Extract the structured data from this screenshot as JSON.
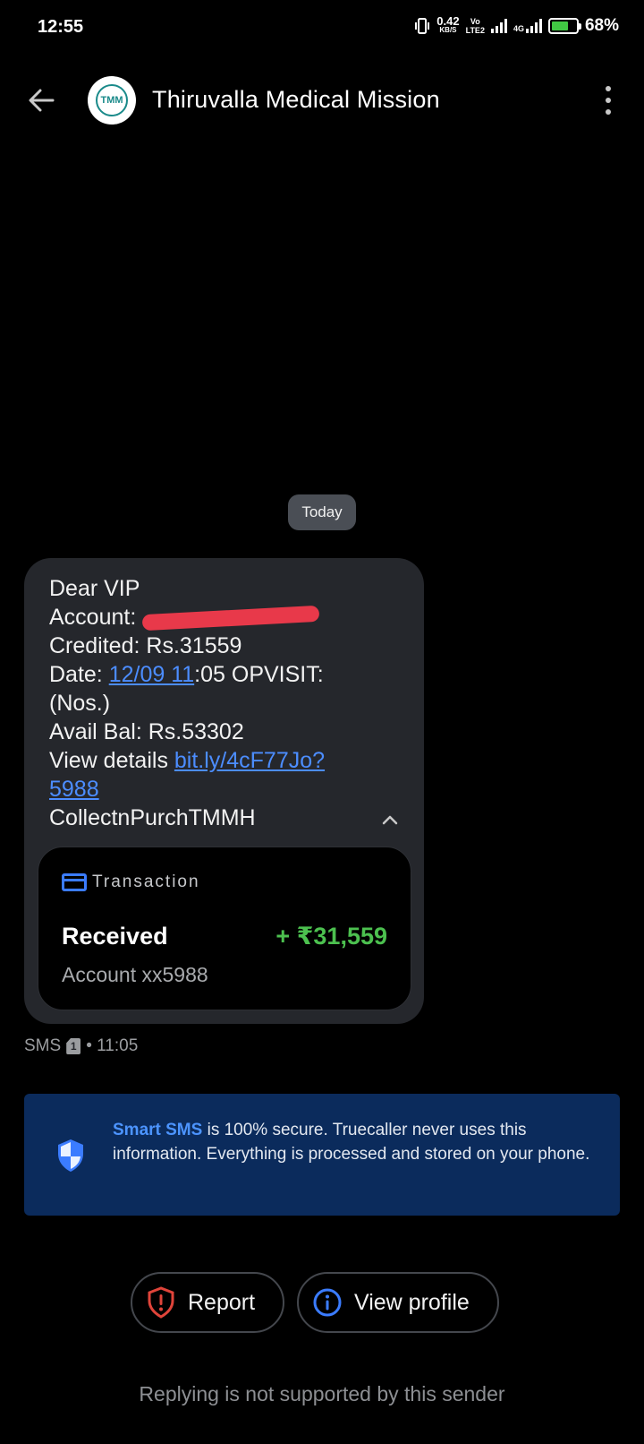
{
  "status_bar": {
    "time": "12:55",
    "net_speed_value": "0.42",
    "net_speed_unit": "KB/S",
    "volte_label": "Vo",
    "lte_label": "LTE2",
    "network_4g": "4G",
    "battery_percent": "68%"
  },
  "header": {
    "contact_name": "Thiruvalla Medical Mission",
    "avatar_logo": "TMM"
  },
  "date_chip": "Today",
  "message": {
    "line1": "Dear VIP",
    "account_label": "Account: ",
    "credited": "Credited: Rs.31559",
    "date_label": "Date: ",
    "date_link": "12/09 11",
    "date_rest": ":05 OPVISIT:",
    "nos": "(Nos.)",
    "avail_bal": "Avail Bal: Rs.53302",
    "view_details_label": "View details ",
    "link_part1": "bit.ly/4cF77Jo?",
    "link_part2": "5988",
    "signature": "CollectnPurchTMMH"
  },
  "transaction": {
    "header": "Transaction",
    "status": "Received",
    "amount": "+ ₹31,559",
    "account": "Account xx5988"
  },
  "meta": {
    "type": "SMS",
    "sim": "1",
    "time": "• 11:05"
  },
  "info_banner": {
    "brand": "Smart SMS",
    "text": " is 100% secure. Truecaller never uses this information. Everything is processed and stored on your phone."
  },
  "actions": {
    "report": "Report",
    "view_profile": "View profile"
  },
  "footer_note": "Replying is not supported by this sender",
  "colors": {
    "accent_blue": "#4c8dff",
    "amount_green": "#4cc04f",
    "banner_bg": "#0b2b5c",
    "report_red": "#e0443a"
  }
}
